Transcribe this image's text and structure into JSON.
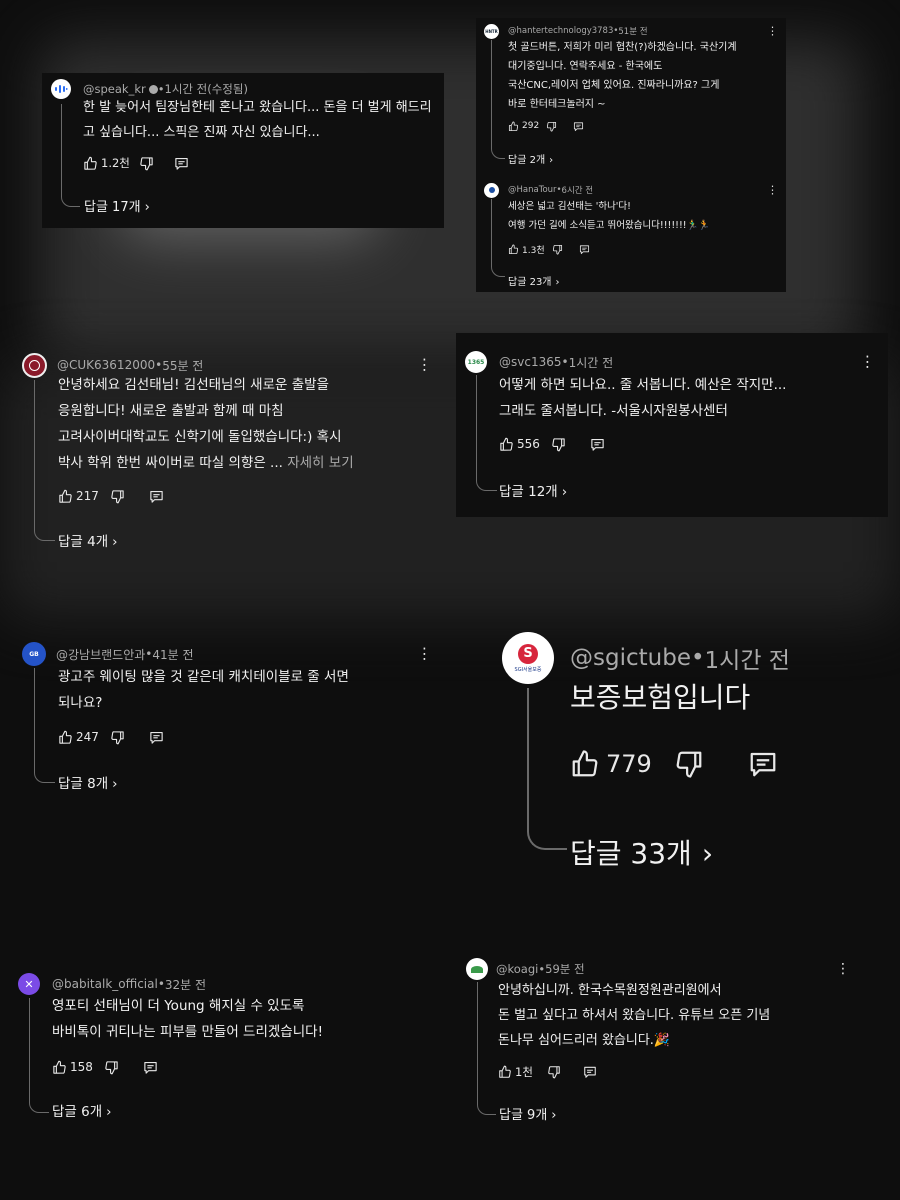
{
  "comments": [
    {
      "handle": "@speak_kr",
      "time": "1시간 전(수정됨)",
      "text": "한 발 늦어서 팀장님한테 혼나고 왔습니다... 돈을 더 벌게 해드리고 싶습니다... 스픽은 진짜 자신 있습니다...",
      "likes": "1.2천",
      "replies": "답글 17개"
    },
    {
      "handle": "@hantertechnology3783",
      "time": "51분 전",
      "text": "첫 골드버튼, 저희가 미리 협찬(?)하겠습니다. 국산기계\n대기중입니다. 연락주세요  - 한국에도\n국산CNC,레이저 업체 있어요. 진짜라니까요? 그게\n바로 한터테크놀러지 ~",
      "likes": "292",
      "replies": "답글 2개"
    },
    {
      "handle": "@HanaTour",
      "time": "6시간 전",
      "text": "세상은 넓고 김선태는 '하나'다!\n여행 가던 길에 소식듣고 뛰어왔습니다!!!!!!!🏃‍♂️🏃",
      "likes": "1.3천",
      "replies": "답글 23개"
    },
    {
      "handle": "@CUK63612000",
      "time": "55분 전",
      "text": "안녕하세요 김선태님! 김선태님의 새로운 출발을\n응원합니다! 새로운 출발과 함께 때 마침\n고려사이버대학교도 신학기에 돌입했습니다:) 혹시\n박사 학위 한번 싸이버로 따실 의향은 ...",
      "more": "자세히 보기",
      "likes": "217",
      "replies": "답글 4개"
    },
    {
      "handle": "@svc1365",
      "time": "1시간 전",
      "text": "어떻게 하면 되나요.. 줄 서봅니다. 예산은 작지만...\n그래도 줄서봅니다. -서울시자원봉사센터",
      "likes": "556",
      "replies": "답글 12개"
    },
    {
      "handle": "@강남브랜드안과",
      "time": "41분 전",
      "text": "광고주 웨이팅 많을 것 같은데 캐치테이블로 줄 서면\n되나요?",
      "likes": "247",
      "replies": "답글 8개"
    },
    {
      "handle": "@sgictube",
      "time": "1시간 전",
      "text": "보증보험입니다",
      "likes": "779",
      "replies": "답글 33개",
      "logo": "SGI서울보증"
    },
    {
      "handle": "@babitalk_official",
      "time": "32분 전",
      "text": "영포티 선태님이 더 Young 해지실 수 있도록\n바비톡이 귀티나는 피부를 만들어 드리겠습니다!",
      "likes": "158",
      "replies": "답글 6개"
    },
    {
      "handle": "@koagi",
      "time": "59분 전",
      "text": "안녕하십니까. 한국수목원정원관리원에서\n돈 벌고 싶다고 하셔서 왔습니다. 유튜브 오픈 기념\n돈나무 심어드리러 왔습니다.🎉",
      "likes": "1천",
      "replies": "답글 9개"
    }
  ],
  "separator": " • ",
  "icons": [
    "like-icon",
    "dislike-icon",
    "comment-icon",
    "more-icon",
    "chevron-right-icon",
    "verified-icon"
  ],
  "colors": {
    "background": "#0e0e0e",
    "text": "#f1f1f1",
    "muted": "#aaaaaa"
  }
}
